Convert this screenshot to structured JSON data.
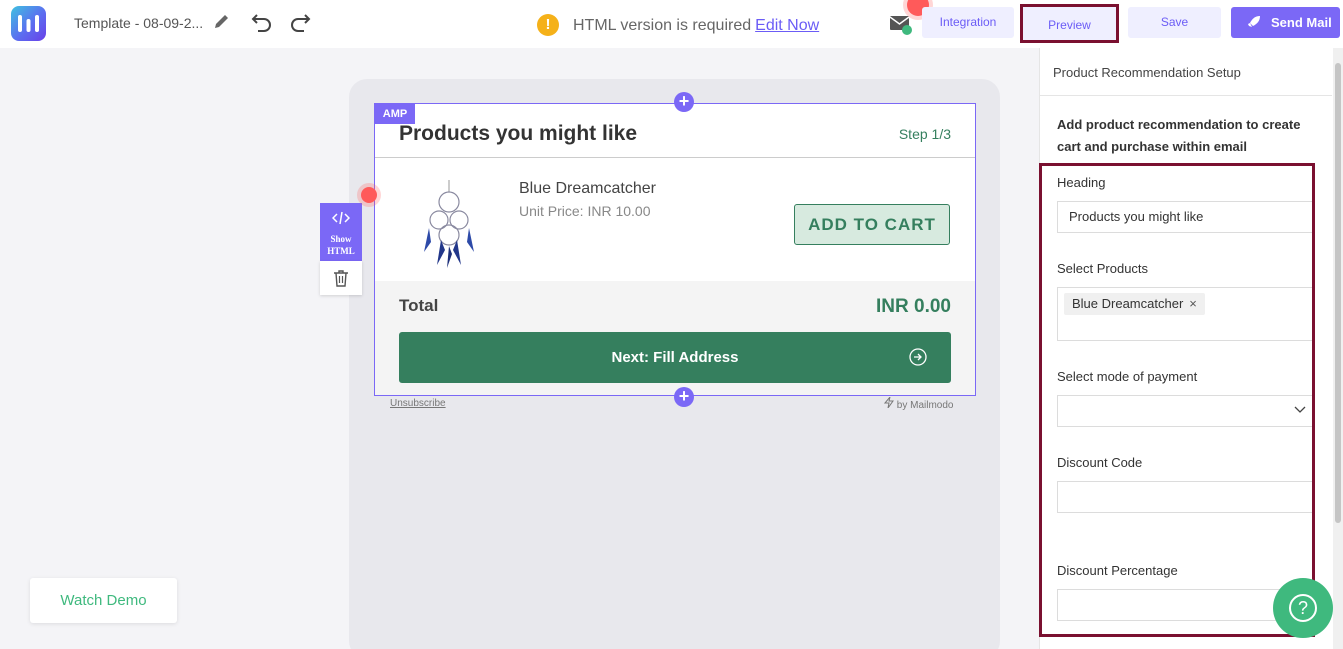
{
  "topbar": {
    "template_name": "Template - 08-09-2...",
    "warning_text": "HTML version is required",
    "warning_link": "Edit Now",
    "integration_label": "Integration",
    "preview_label": "Preview",
    "save_label": "Save",
    "send_label": "Send Mail"
  },
  "email": {
    "amp_tag": "AMP",
    "title": "Products you might like",
    "step": "Step 1/3",
    "product_name": "Blue Dreamcatcher",
    "product_price": "Unit Price: INR 10.00",
    "add_to_cart": "ADD TO CART",
    "total_label": "Total",
    "total_value": "INR 0.00",
    "next_label": "Next: Fill Address",
    "unsubscribe": "Unsubscribe",
    "by": "by Mailmodo"
  },
  "tools": {
    "show_html": "Show HTML"
  },
  "watch_demo": "Watch Demo",
  "panel": {
    "title": "Product Recommendation Setup",
    "description": "Add product recommendation to create cart and purchase within email",
    "heading_label": "Heading",
    "heading_value": "Products you might like",
    "products_label": "Select Products",
    "selected_product": "Blue Dreamcatcher",
    "payment_label": "Select mode of payment",
    "discount_code_label": "Discount Code",
    "discount_pct_label": "Discount Percentage"
  },
  "colors": {
    "brand": "#7b68f6",
    "accent_green": "#357f5e",
    "highlight": "#7a1030"
  }
}
